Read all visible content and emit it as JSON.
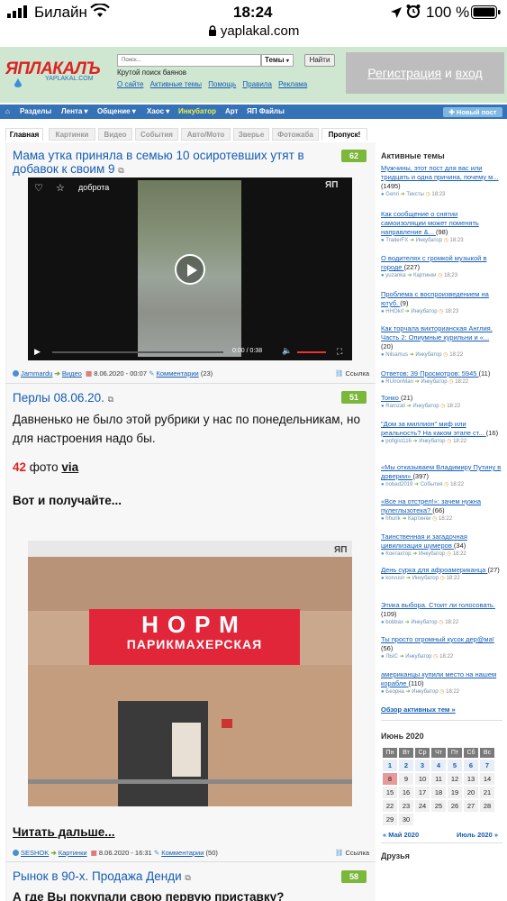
{
  "status_bar": {
    "carrier": "Билайн",
    "time": "18:24",
    "battery": "100 %"
  },
  "url": "yaplakal.com",
  "header": {
    "logo_text": "ЯПЛАКАЛЪ",
    "logo_sub": "YAPLAKAL.COM",
    "search_placeholder": "Поиск...",
    "search_select": "Темы",
    "search_button": "Найти",
    "search_hint": "Крутой поиск баянов",
    "links": [
      "О сайте",
      "Активные темы",
      "Помощь",
      "Правила",
      "Реклама"
    ],
    "register": "Регистрация",
    "register_and": "и",
    "login": "вход"
  },
  "nav": {
    "items": [
      "Разделы",
      "Лента ▾",
      "Общение ▾",
      "Хаос ▾",
      "Инкубатор",
      "Арт",
      "ЯП Файлы"
    ],
    "new_post": "Новый пост"
  },
  "tabs": [
    "Главная",
    "Картинки",
    "Видео",
    "События",
    "Авто/Мото",
    "Зверье",
    "Фотожаба",
    "Пропуск!"
  ],
  "posts": [
    {
      "title": "Мама утка приняла в семью 10 осиротевших утят в добавок к своим 9",
      "score": "62",
      "video_label": "доброта",
      "video_time": "0:00 / 0:38",
      "meta": {
        "author": "Jammardu",
        "section": "Видео",
        "date": "8.06.2020 - 00:07",
        "comments": "Комментарии",
        "comments_count": "(23)",
        "link": "Ссылка"
      }
    },
    {
      "title": "Перлы 08.06.20.",
      "score": "51",
      "text": "Давненько не было этой рубрики у нас по понедельникам, но для настроения надо бы.",
      "photo_count": "42",
      "photo_word": "фото",
      "via": "via",
      "lead": "Вот и получайте...",
      "sign_top": "НОРМ",
      "sign_bottom": "ПАРИКМАХЕРСКАЯ",
      "read_more": "Читать дальше...",
      "meta": {
        "author": "SESHOK",
        "section": "Картинки",
        "date": "8.06.2020 - 16:31",
        "comments": "Комментарии",
        "comments_count": "(50)",
        "link": "Ссылка"
      }
    },
    {
      "title": "Рынок в 90-х. Продажа Денди",
      "score": "58",
      "text": "А где Вы покупали свою первую приставку?"
    }
  ],
  "active_topics": {
    "heading": "Активные темы",
    "items": [
      {
        "title": "Мужчины, этот пост для вас или тридцать и одна причина, почему м...",
        "count": "(1495)",
        "user": "Genri",
        "section": "Тексты",
        "time": "18:23"
      },
      {
        "title": "Как сообщение о снятии самоизоляции может поменять направление &...",
        "count": "(98)",
        "user": "TraderFX",
        "section": "Инкубатор",
        "time": "18:23"
      },
      {
        "title": "О водителях с громкой музыкой в городе",
        "count": "(227)",
        "user": "yuzanka",
        "section": "Картинки",
        "time": "18:23"
      },
      {
        "title": "Проблема с воспроизведением на ютуб.",
        "count": "(9)",
        "user": "HHOkrl",
        "section": "Инкубатор",
        "time": "18:23"
      },
      {
        "title": "Как торчала викторианская Англия. Часть 2: Опиумные курильни и «...",
        "count": "(20)",
        "user": "Nilsamus",
        "section": "Инкубатор",
        "time": "18:22"
      },
      {
        "title": "Ответов: 39 Просмотров: 5945",
        "count": "(11)",
        "user": "RUIronMan",
        "section": "Инкубатор",
        "time": "18:22"
      },
      {
        "title": "Тонко",
        "count": "(21)",
        "user": "Ramzali",
        "section": "Инкубатор",
        "time": "18:22"
      },
      {
        "title": "\"Дом за миллион\" миф или реальность? На каком этапе ст...",
        "count": "(16)",
        "user": "pofigist116",
        "section": "Инкубатор",
        "time": "18:22"
      },
      {
        "title": "«Мы отказываем Владимиру Путину в доверии»",
        "count": "(397)",
        "user": "nobad2019",
        "section": "События",
        "time": "18:22"
      },
      {
        "title": "«Все на отстрел!»: зачем нужна пулеглызотека?",
        "count": "(66)",
        "user": "hhurik",
        "section": "Картинки",
        "time": "18:22"
      },
      {
        "title": "Таинственная и загадочная цивилизация шумеров",
        "count": "(34)",
        "user": "Контактор",
        "section": "Инкубатор",
        "time": "18:22"
      },
      {
        "title": "День сурка для афроамериканца",
        "count": "(27)",
        "user": "korvusn",
        "section": "Инкубатор",
        "time": "18:22"
      },
      {
        "title": "Этика выбора. Стоит ли голосовать.",
        "count": "(109)",
        "user": "bobbax",
        "section": "Инкубатор",
        "time": "18:22"
      },
      {
        "title": "Ты просто огромный кусок дер@ма!",
        "count": "(56)",
        "user": "ЛЫС",
        "section": "Инкубатор",
        "time": "18:22"
      },
      {
        "title": "американцы купили место на нашем корабле",
        "count": "(110)",
        "user": "Беорна",
        "section": "Инкубатор",
        "time": "18:22"
      }
    ],
    "overview": "Обзор активных тем »"
  },
  "calendar": {
    "title": "Июнь 2020",
    "days": [
      "Пн",
      "Вт",
      "Ср",
      "Чт",
      "Пт",
      "Сб",
      "Вс"
    ],
    "weeks": [
      [
        "1",
        "2",
        "3",
        "4",
        "5",
        "6",
        "7"
      ],
      [
        "8",
        "9",
        "10",
        "11",
        "12",
        "13",
        "14"
      ],
      [
        "15",
        "16",
        "17",
        "18",
        "19",
        "20",
        "21"
      ],
      [
        "22",
        "23",
        "24",
        "25",
        "26",
        "27",
        "28"
      ],
      [
        "29",
        "30",
        "",
        "",
        "",
        "",
        ""
      ]
    ],
    "prev": "« Май 2020",
    "next": "Июль 2020 »"
  },
  "friends_heading": "Друзья",
  "colors": {
    "nav": "#3572b6",
    "header": "#cfe6d0",
    "score": "#7ab73a",
    "link": "#145db5"
  }
}
